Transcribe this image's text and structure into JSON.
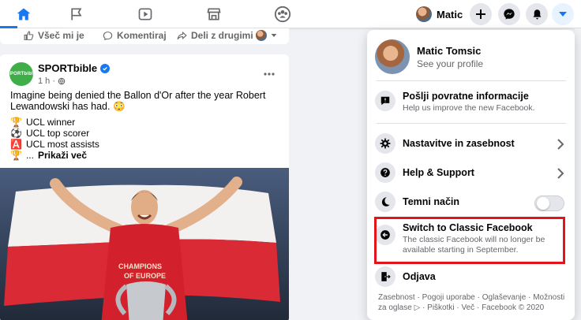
{
  "colors": {
    "brand": "#1877f2",
    "highlight": "#e3141c",
    "sportbible": "#3fae49"
  },
  "topbar": {
    "profile_name": "Matic",
    "icons": [
      "home-icon",
      "flag-icon",
      "video-icon",
      "marketplace-icon",
      "groups-icon",
      "plus-icon",
      "messenger-icon",
      "notifications-icon",
      "menu-caret-icon"
    ]
  },
  "action_row": {
    "like": "Všeč mi je",
    "comment": "Komentiraj",
    "share": "Deli z drugimi"
  },
  "post": {
    "avatar_text": "SPORTbible",
    "author": "SPORTbible",
    "time": "1 h ·",
    "text": "Imagine being denied the Ballon d'Or after the year Robert Lewandowski has had. 😳",
    "lines": [
      {
        "emoji": "🏆",
        "text": "UCL winner"
      },
      {
        "emoji": "⚽",
        "text": "UCL top scorer"
      },
      {
        "emoji": "🅰️",
        "text": "UCL most assists"
      }
    ],
    "more_emoji": "🏆",
    "more_prefix": "...",
    "more_label": "Prikaži več",
    "image_texts": [
      "CHAMPIONS",
      "OF EUROPE"
    ]
  },
  "menu": {
    "profile_name": "Matic Tomsic",
    "profile_sub": "See your profile",
    "feedback_title": "Pošlji povratne informacije",
    "feedback_desc": "Help us improve the new Facebook.",
    "settings": "Nastavitve in zasebnost",
    "help": "Help & Support",
    "dark_mode": "Temni način",
    "classic_title": "Switch to Classic Facebook",
    "classic_desc": "The classic Facebook will no longer be available starting in September.",
    "logout": "Odjava",
    "footer": "Zasebnost · Pogoji uporabe · Oglaševanje · Možnosti za oglase ▷ · Piškotki · Več · Facebook © 2020"
  }
}
